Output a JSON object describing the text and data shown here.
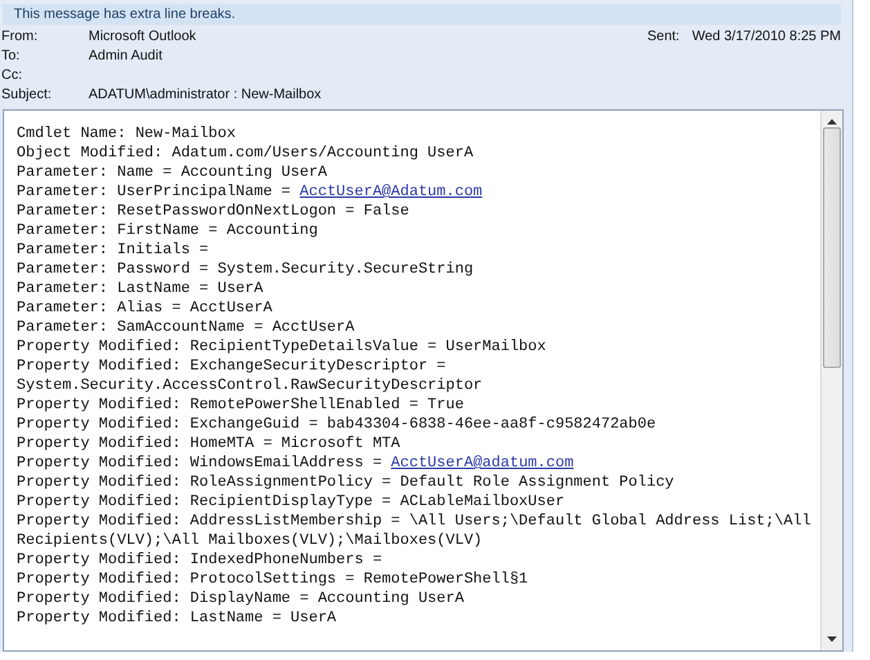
{
  "infobar": {
    "text": "This message has extra line breaks."
  },
  "header": {
    "fields": [
      {
        "label": "From:",
        "value": "Microsoft Outlook"
      },
      {
        "label": "To:",
        "value": "Admin Audit"
      },
      {
        "label": "Cc:"
      },
      {
        "label": "Subject:",
        "value": "ADATUM\\administrator : New-Mailbox"
      }
    ],
    "sent": {
      "label": "Sent:",
      "value": "Wed 3/17/2010 8:25 PM"
    }
  },
  "body": {
    "lines": [
      {
        "text": "Cmdlet Name: New-Mailbox"
      },
      {
        "text": "Object Modified: Adatum.com/Users/Accounting UserA"
      },
      {
        "text": "Parameter: Name = Accounting UserA"
      },
      {
        "text": "Parameter: UserPrincipalName = ",
        "link": "AcctUserA@Adatum.com"
      },
      {
        "text": "Parameter: ResetPasswordOnNextLogon = False"
      },
      {
        "text": "Parameter: FirstName = Accounting"
      },
      {
        "text": "Parameter: Initials ="
      },
      {
        "text": "Parameter: Password = System.Security.SecureString"
      },
      {
        "text": "Parameter: LastName = UserA"
      },
      {
        "text": "Parameter: Alias = AcctUserA"
      },
      {
        "text": "Parameter: SamAccountName = AcctUserA"
      },
      {
        "text": "Property Modified: RecipientTypeDetailsValue = UserMailbox"
      },
      {
        "text": "Property Modified: ExchangeSecurityDescriptor ="
      },
      {
        "text": "System.Security.AccessControl.RawSecurityDescriptor"
      },
      {
        "text": "Property Modified: RemotePowerShellEnabled = True"
      },
      {
        "text": "Property Modified: ExchangeGuid = bab43304-6838-46ee-aa8f-c9582472ab0e"
      },
      {
        "text": "Property Modified: HomeMTA = Microsoft MTA"
      },
      {
        "text": "Property Modified: WindowsEmailAddress = ",
        "link": "AcctUserA@adatum.com"
      },
      {
        "text": "Property Modified: RoleAssignmentPolicy = Default Role Assignment Policy"
      },
      {
        "text": "Property Modified: RecipientDisplayType = ACLableMailboxUser"
      },
      {
        "text": "Property Modified: AddressListMembership = \\All Users;\\Default Global Address List;\\All"
      },
      {
        "text": "Recipients(VLV);\\All Mailboxes(VLV);\\Mailboxes(VLV)"
      },
      {
        "text": "Property Modified: IndexedPhoneNumbers ="
      },
      {
        "text": "Property Modified: ProtocolSettings = RemotePowerShell§1"
      },
      {
        "text": "Property Modified: DisplayName = Accounting UserA"
      },
      {
        "text": "Property Modified: LastName = UserA"
      }
    ]
  }
}
